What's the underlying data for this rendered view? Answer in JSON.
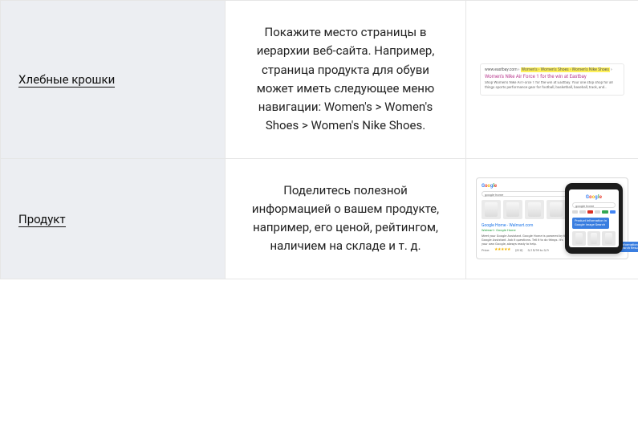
{
  "rows": [
    {
      "title": "Хлебные крошки",
      "description": "Покажите место страницы в иерархии веб-сайта. Например, страница продукта для обуви может иметь следующее меню навигации: Women's > Women's Shoes > Women's Nike Shoes.",
      "serp": {
        "breadcrumb_prefix": "www.eastbay.com ›",
        "breadcrumb_hilite": "Women's › Women's Shoes › Women's Nike Shoes",
        "breadcrumb_suffix": " ›",
        "title": "Women's Nike Air Force 1 for the win at Eastbay",
        "snippet": "Shop Women's Nike Air Force 1 for the win at Eastbay. Your one stop shop for all things sports performance gear for football, basketball, baseball, track, and…"
      }
    },
    {
      "title": "Продукт",
      "description": "Поделитесь полезной информацией о вашем продукте, например, его ценой, рейтингом, наличием на складе и т. д.",
      "product": {
        "logo_letters": [
          "G",
          "o",
          "o",
          "g",
          "l",
          "e"
        ],
        "search_query": "google home",
        "blue_label_phone": "Product Information in Google Image Search",
        "result_title": "Google Home - Walmart.com",
        "result_sub": "Walmart › Google Home",
        "result_snippet": "Meet your Google Assistant. Google Home is powered by the Google Assistant. Ask it questions. Tell it to do things. It's your own Google, always ready to help.",
        "result_price": "Price:",
        "result_stars": "★★★★★",
        "result_reviews": "(818)",
        "result_date": "3/15/99 to 3/9",
        "blue_label_bottom": "Product Information in Google Search Results"
      }
    }
  ]
}
